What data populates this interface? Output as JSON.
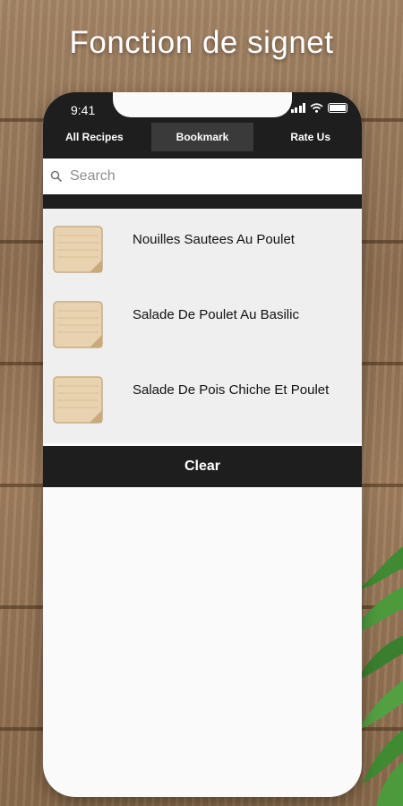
{
  "headline": "Fonction de signet",
  "status": {
    "time": "9:41"
  },
  "tabs": [
    {
      "label": "All Recipes"
    },
    {
      "label": "Bookmark"
    },
    {
      "label": "Rate Us"
    }
  ],
  "search": {
    "placeholder": "Search",
    "value": ""
  },
  "bookmarks": [
    {
      "title": "Nouilles Sautees Au Poulet"
    },
    {
      "title": "Salade De Poulet Au Basilic"
    },
    {
      "title": "Salade De Pois Chiche Et Poulet"
    }
  ],
  "clear_label": "Clear",
  "colors": {
    "bar": "#1e1e1e",
    "active_tab": "#3a3a3a",
    "list_bg": "#efefef"
  }
}
